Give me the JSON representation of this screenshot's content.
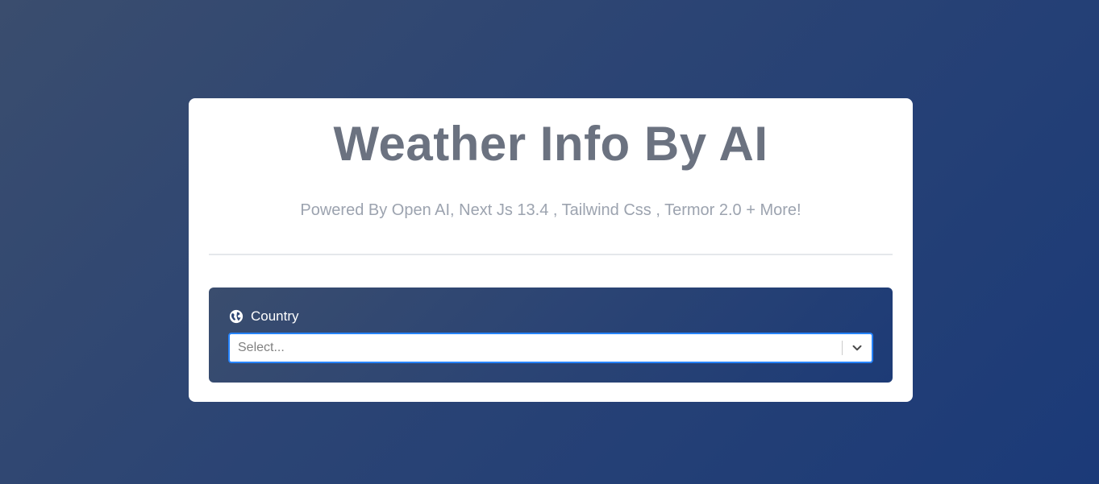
{
  "header": {
    "title": "Weather Info By AI",
    "subtitle": "Powered By Open AI, Next Js 13.4 , Tailwind Css , Termor 2.0 + More!"
  },
  "country_picker": {
    "icon": "globe-icon",
    "label": "Country",
    "placeholder": "Select...",
    "dropdown_icon": "chevron-down-icon"
  },
  "colors": {
    "title_text": "#6b7280",
    "subtitle_text": "#9ca3af",
    "focus_border": "#2684ff",
    "panel_bg": "#2b4474"
  }
}
